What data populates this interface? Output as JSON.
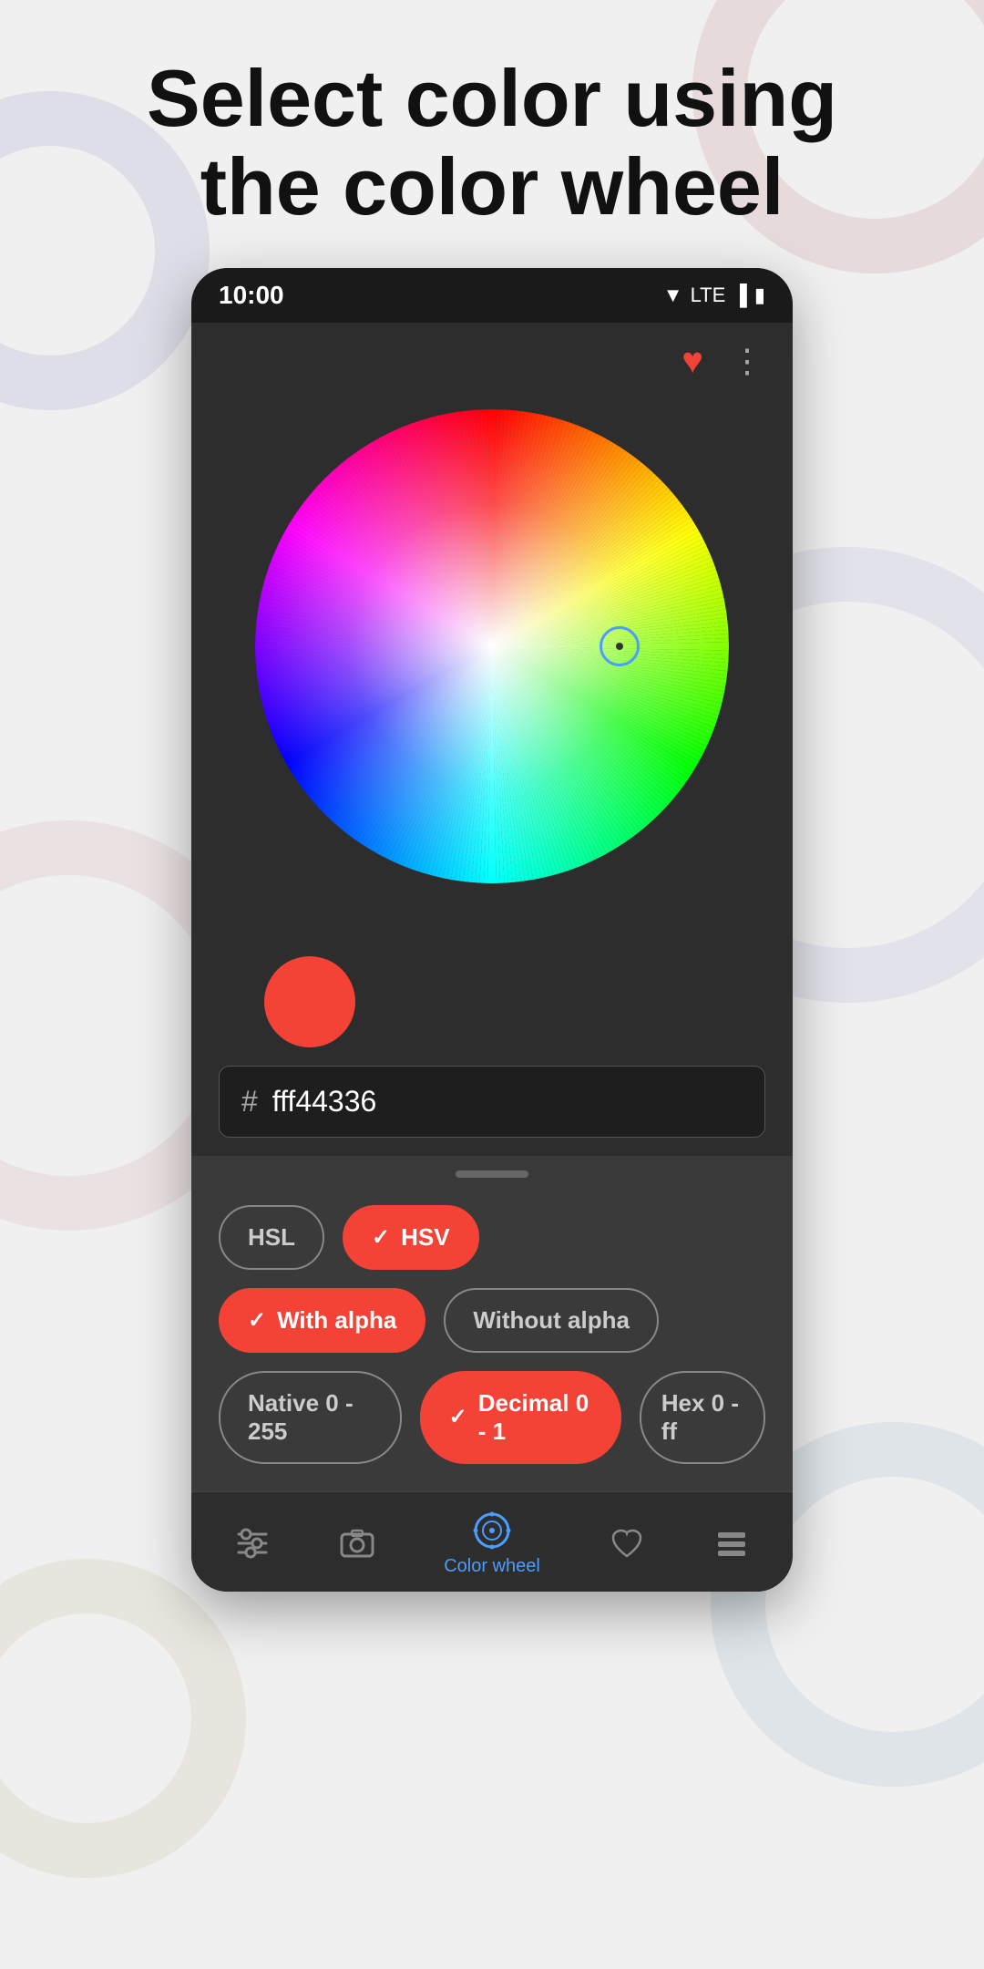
{
  "header": {
    "title_line1": "Select color using",
    "title_line2": "the color wheel"
  },
  "status_bar": {
    "time": "10:00",
    "signal": "▼",
    "lte": "LTE",
    "battery": "🔋"
  },
  "color_picker": {
    "hex_hash": "#",
    "hex_value": "fff44336",
    "selected_color": "#f44336"
  },
  "bottom_sheet": {
    "options_row1": [
      {
        "id": "hsl",
        "label": "HSL",
        "active": false
      },
      {
        "id": "hsv",
        "label": "HSV",
        "active": true
      }
    ],
    "options_row2": [
      {
        "id": "with-alpha",
        "label": "With alpha",
        "active": true
      },
      {
        "id": "without-alpha",
        "label": "Without alpha",
        "active": false
      }
    ],
    "options_row3": [
      {
        "id": "native",
        "label": "Native 0 - 255",
        "active": false
      },
      {
        "id": "decimal",
        "label": "Decimal 0 - 1",
        "active": true
      },
      {
        "id": "hex",
        "label": "Hex 0 - ff",
        "active": false
      }
    ]
  },
  "bottom_nav": [
    {
      "id": "sliders",
      "icon": "⊟",
      "label": "",
      "active": false
    },
    {
      "id": "camera",
      "icon": "📷",
      "label": "",
      "active": false
    },
    {
      "id": "color-wheel",
      "icon": "◎",
      "label": "Color wheel",
      "active": true
    },
    {
      "id": "favorites",
      "icon": "♡",
      "label": "",
      "active": false
    },
    {
      "id": "list",
      "icon": "≡",
      "label": "",
      "active": false
    }
  ]
}
